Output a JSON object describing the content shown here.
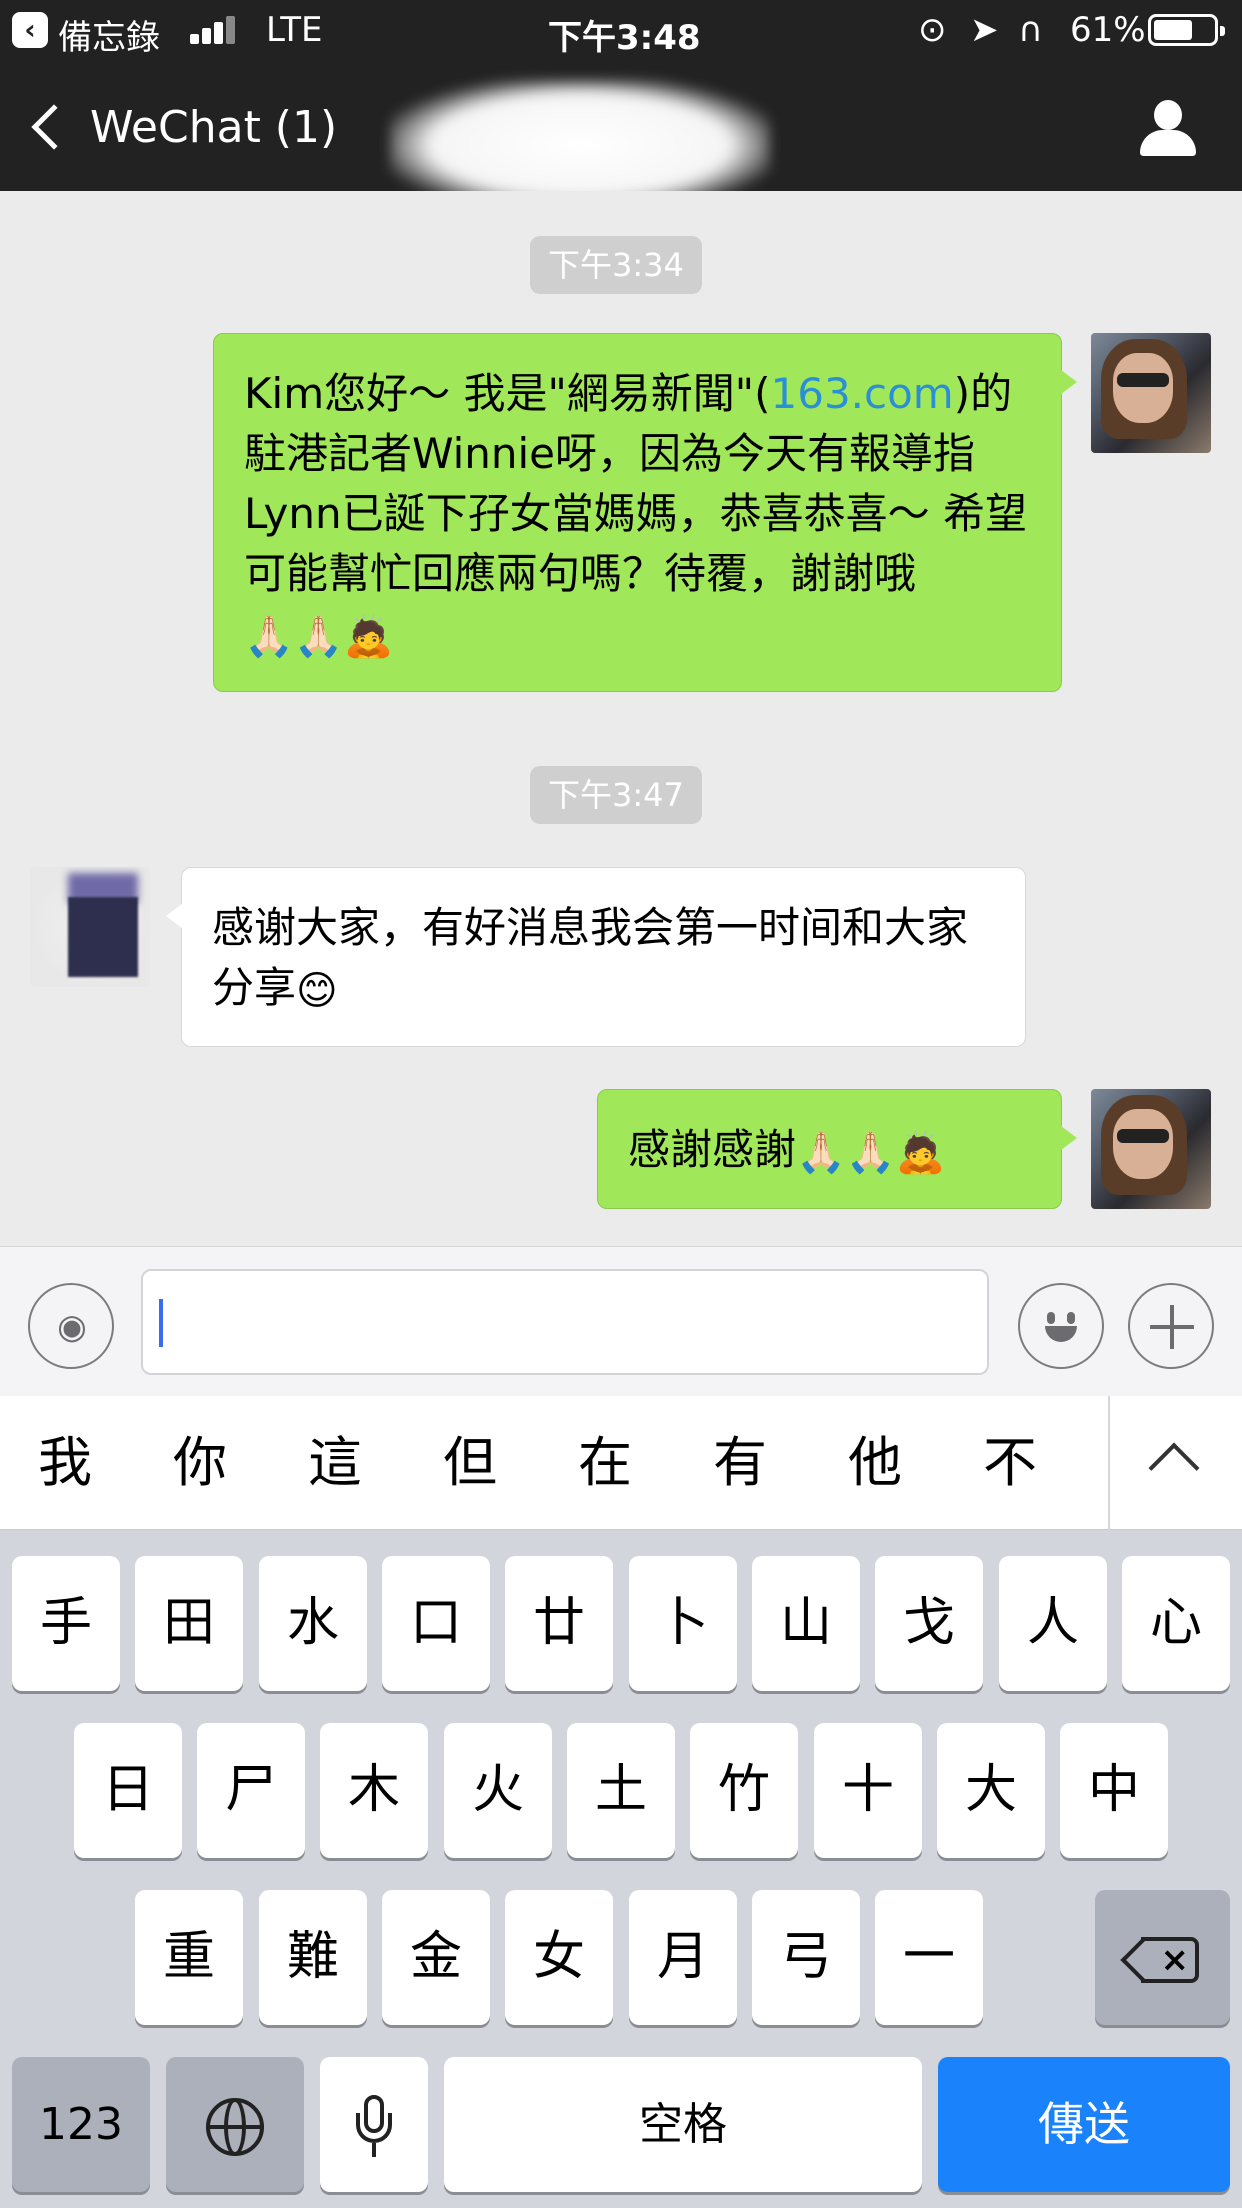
{
  "status_bar": {
    "back_app": "備忘錄",
    "network": "LTE",
    "time": "下午3:48",
    "battery": "61%",
    "battery_level": 0.61
  },
  "nav": {
    "back_label": "WeChat (1)"
  },
  "messages": [
    {
      "type": "time",
      "text": "下午3:34"
    },
    {
      "type": "out",
      "text_before_link": "Kim您好～ 我是\"網易新聞\"(",
      "link": "163.com",
      "text_after_link": ")的駐港記者Winnie呀，因為今天有報導指Lynn已誕下孖女當媽媽，恭喜恭喜～ 希望可能幫忙回應兩句嗎？待覆，謝謝哦",
      "emojis": "🙏🏻🙏🏻🙇"
    },
    {
      "type": "time",
      "text": "下午3:47"
    },
    {
      "type": "in",
      "text": "感谢大家，有好消息我会第一时间和大家分享",
      "emojis": "😊"
    },
    {
      "type": "out",
      "text": "感謝感謝",
      "emojis": "🙏🏻🙏🏻🙇"
    }
  ],
  "input_bar": {
    "value": "",
    "icons": [
      "voice-icon",
      "emoji-icon",
      "plus-icon"
    ]
  },
  "candidates": [
    "我",
    "你",
    "這",
    "但",
    "在",
    "有",
    "他",
    "不"
  ],
  "keyboard": {
    "row1": [
      "手",
      "田",
      "水",
      "口",
      "廿",
      "卜",
      "山",
      "戈",
      "人",
      "心"
    ],
    "row2": [
      "日",
      "尸",
      "木",
      "火",
      "土",
      "竹",
      "十",
      "大",
      "中"
    ],
    "row3": [
      "重",
      "難",
      "金",
      "女",
      "月",
      "弓",
      "一"
    ],
    "numbers_key": "123",
    "space_key": "空格",
    "send_key": "傳送"
  },
  "colors": {
    "header": "#222222",
    "outgoing_bubble": "#a0e75a",
    "incoming_bubble": "#ffffff",
    "link": "#2a8fd6",
    "send_key": "#1a82fb"
  }
}
